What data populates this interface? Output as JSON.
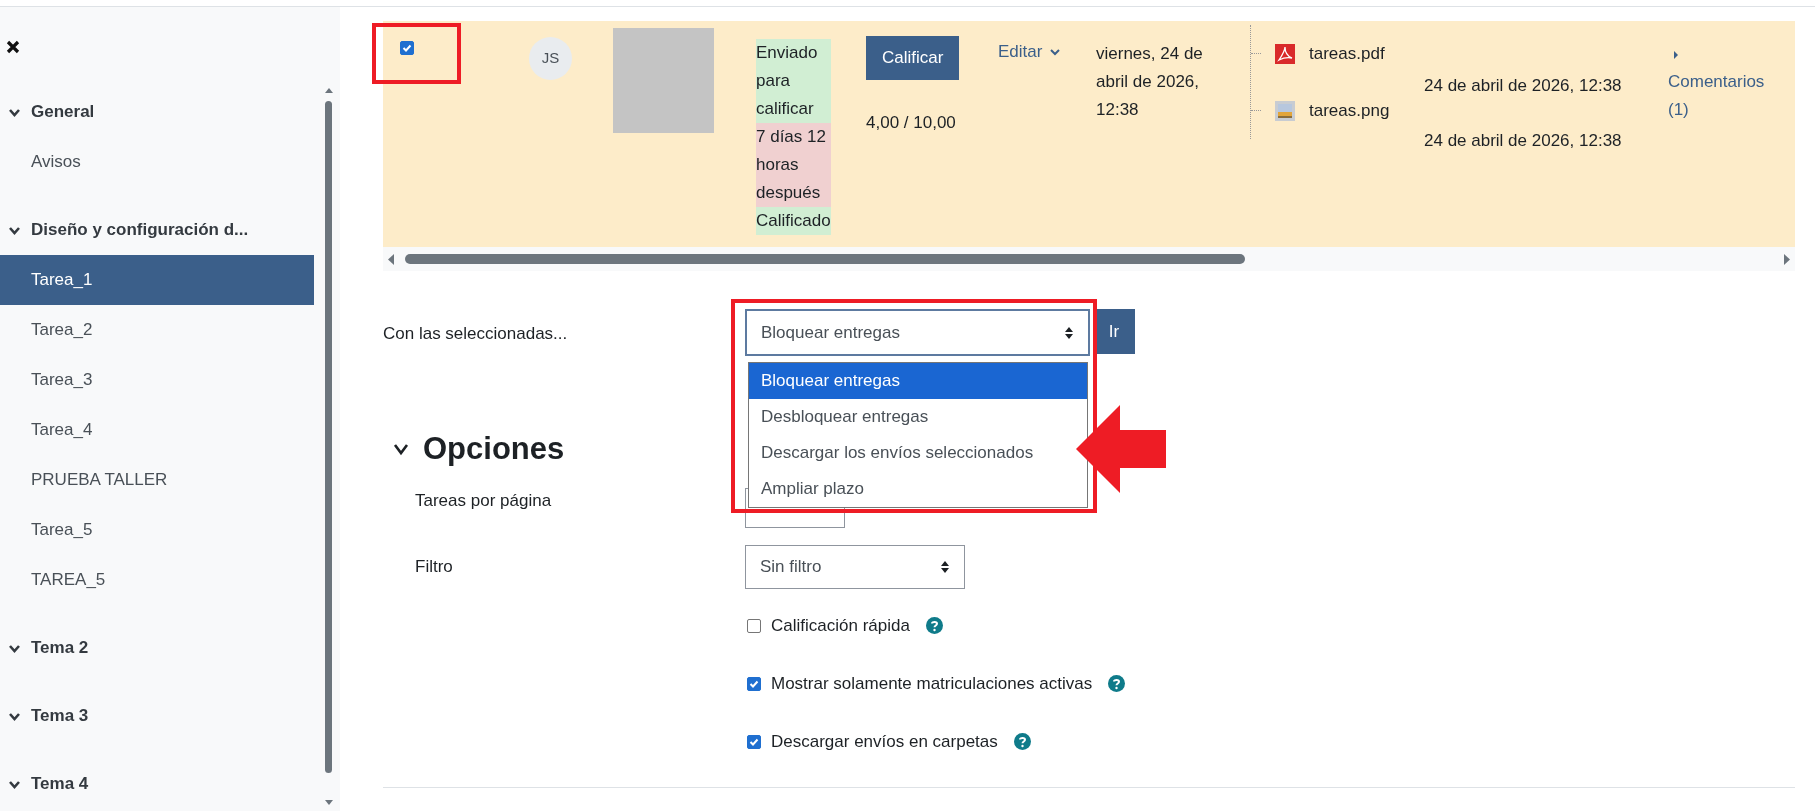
{
  "sidebar": {
    "sections": [
      {
        "title": "General",
        "expanded": true,
        "items": [
          {
            "label": "Avisos",
            "selected": false
          }
        ]
      },
      {
        "title": "Diseño y configuración d...",
        "expanded": true,
        "items": [
          {
            "label": "Tarea_1",
            "selected": true
          },
          {
            "label": "Tarea_2",
            "selected": false
          },
          {
            "label": "Tarea_3",
            "selected": false
          },
          {
            "label": "Tarea_4",
            "selected": false
          },
          {
            "label": "PRUEBA TALLER",
            "selected": false
          },
          {
            "label": "Tarea_5",
            "selected": false
          },
          {
            "label": "TAREA_5",
            "selected": false
          }
        ]
      },
      {
        "title": "Tema 2",
        "expanded": true
      },
      {
        "title": "Tema 3",
        "expanded": true
      },
      {
        "title": "Tema 4",
        "expanded": true
      }
    ]
  },
  "submission_row": {
    "selected": true,
    "initials": "JS",
    "status": [
      {
        "text": "Enviado para calificar",
        "kind": "ok"
      },
      {
        "text": "7 días 12 horas después",
        "kind": "late"
      },
      {
        "text": "Calificado",
        "kind": "ok"
      }
    ],
    "grade_button": "Calificar",
    "grade": "4,00 / 10,00",
    "edit_menu": "Editar",
    "modified": "viernes, 24 de abril de 2026, 12:38",
    "files": [
      {
        "name": "tareas.pdf",
        "kind": "pdf",
        "time": "24 de abril de 2026, 12:38"
      },
      {
        "name": "tareas.png",
        "kind": "image",
        "time": "24 de abril de 2026, 12:38"
      }
    ],
    "comments": {
      "label": "Comentarios (1)",
      "expanded": false
    }
  },
  "bulk_actions": {
    "label": "Con las seleccionadas...",
    "value": "Bloquear entregas",
    "button": "Ir",
    "options": [
      {
        "label": "Bloquear entregas",
        "selected": true
      },
      {
        "label": "Desbloquear entregas",
        "selected": false
      },
      {
        "label": "Descargar los envíos seleccionados",
        "selected": false
      },
      {
        "label": "Ampliar plazo",
        "selected": false
      }
    ]
  },
  "options": {
    "title": "Opciones",
    "expanded": true,
    "per_page_label": "Tareas por página",
    "filter_label": "Filtro",
    "filter_value": "Sin filtro",
    "checkboxes": [
      {
        "label": "Calificación rápida",
        "checked": false
      },
      {
        "label": "Mostrar solamente matriculaciones activas",
        "checked": true
      },
      {
        "label": "Descargar envíos en carpetas",
        "checked": true
      }
    ]
  }
}
